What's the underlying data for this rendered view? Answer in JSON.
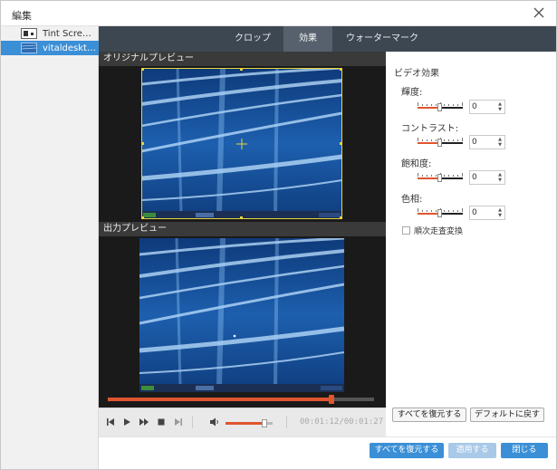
{
  "window": {
    "title": "編集"
  },
  "files": [
    {
      "name": "Tint Screen…",
      "selected": false
    },
    {
      "name": "vitaldesktop…",
      "selected": true
    }
  ],
  "tabs": [
    {
      "label": "クロップ",
      "active": false
    },
    {
      "label": "効果",
      "active": true
    },
    {
      "label": "ウォーターマーク",
      "active": false
    }
  ],
  "preview": {
    "original_label": "オリジナルプレビュー",
    "output_label": "出力プレビュー",
    "playback_progress": 0.84
  },
  "transport": {
    "timecode": "00:01:12/00:01:27",
    "volume_level": 0.82
  },
  "effects": {
    "heading": "ビデオ効果",
    "items": [
      {
        "label": "輝度:",
        "value": "0",
        "level": 0.5
      },
      {
        "label": "コントラスト:",
        "value": "0",
        "level": 0.5
      },
      {
        "label": "飽和度:",
        "value": "0",
        "level": 0.5
      },
      {
        "label": "色相:",
        "value": "0",
        "level": 0.5
      }
    ],
    "deinterlace_label": "順次走査変換",
    "deinterlace_checked": false,
    "restore_all_label": "すべてを復元する",
    "restore_default_label": "デフォルトに戻す"
  },
  "footer": {
    "restore_all_label": "すべてを復元する",
    "apply_label": "適用する",
    "close_label": "閉じる"
  },
  "colors": {
    "accent": "#e0552f",
    "tab_bar": "#3d4752",
    "primary_button": "#3b8fd6",
    "selection": "#3b8fd6"
  }
}
